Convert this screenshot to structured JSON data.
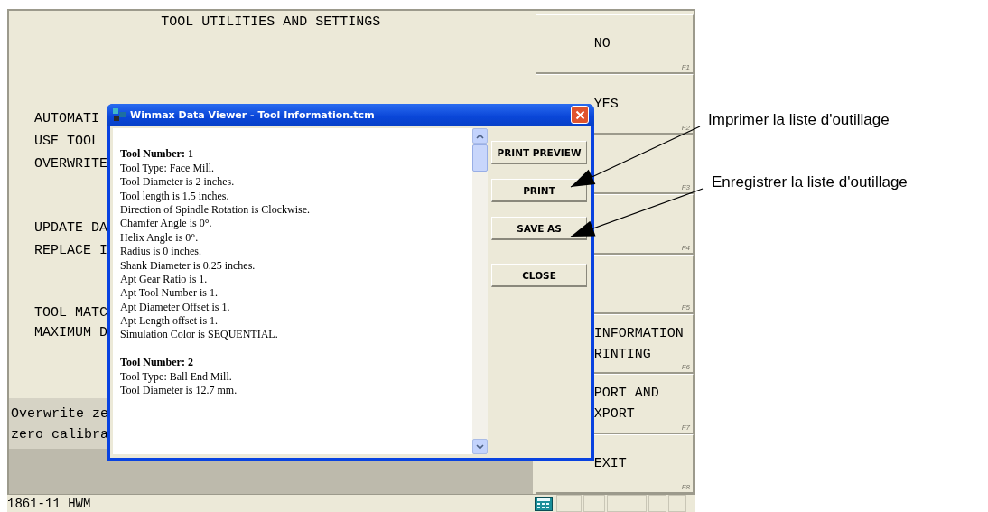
{
  "screen": {
    "title": "TOOL UTILITIES AND SETTINGS",
    "settings": [
      [
        "AUTOMATI",
        "USE TOOL",
        "OVERWRITE"
      ],
      [
        "UPDATE DA",
        "REPLACE I"
      ],
      [
        "TOOL MATC",
        "MAXIMUM D"
      ]
    ],
    "message": [
      "Overwrite ze",
      "zero calibra"
    ],
    "softkeys": [
      {
        "label": [
          "NO"
        ],
        "key": "F1"
      },
      {
        "label": [
          "YES"
        ],
        "key": "F2"
      },
      {
        "key": "F3"
      },
      {
        "key": "F4"
      },
      {
        "key": "F5"
      },
      {
        "label": [
          "INFORMATION",
          "RINTING"
        ],
        "key": "F6"
      },
      {
        "label": [
          "PORT AND",
          "XPORT"
        ],
        "key": "F7"
      },
      {
        "label": [
          "EXIT"
        ],
        "key": "F8"
      }
    ],
    "status_bar": {
      "text": "1861-11 HWM"
    }
  },
  "dialog": {
    "title": "Winmax Data Viewer - Tool Information.tcm",
    "lines": [
      {
        "kind": "blank"
      },
      {
        "kind": "heading",
        "text": "Tool Number: 1"
      },
      {
        "kind": "line",
        "text": "Tool Type: Face Mill."
      },
      {
        "kind": "line",
        "text": "Tool Diameter is 2 inches."
      },
      {
        "kind": "line",
        "text": "Tool length is 1.5 inches."
      },
      {
        "kind": "line",
        "text": "Direction of Spindle Rotation is Clockwise."
      },
      {
        "kind": "line",
        "text": "Chamfer Angle is 0°."
      },
      {
        "kind": "line",
        "text": "Helix Angle is 0°."
      },
      {
        "kind": "line",
        "text": "Radius is 0 inches."
      },
      {
        "kind": "line",
        "text": "Shank Diameter is 0.25 inches."
      },
      {
        "kind": "line",
        "text": "Apt Gear Ratio is 1."
      },
      {
        "kind": "line",
        "text": "Apt Tool Number is 1."
      },
      {
        "kind": "line",
        "text": "Apt Diameter Offset is 1."
      },
      {
        "kind": "line",
        "text": "Apt Length offset is 1."
      },
      {
        "kind": "line",
        "text": "Simulation Color is SEQUENTIAL."
      },
      {
        "kind": "blank"
      },
      {
        "kind": "heading",
        "text": "Tool Number: 2"
      },
      {
        "kind": "line",
        "text": "Tool Type: Ball End Mill."
      },
      {
        "kind": "line",
        "text": "Tool Diameter is 12.7 mm."
      }
    ],
    "buttons": [
      "PRINT PREVIEW",
      "PRINT",
      "SAVE AS",
      "CLOSE"
    ]
  },
  "annotations": [
    {
      "text": "Imprimer la liste d'outillage"
    },
    {
      "text": "Enregistrer la liste d'outillage"
    }
  ]
}
